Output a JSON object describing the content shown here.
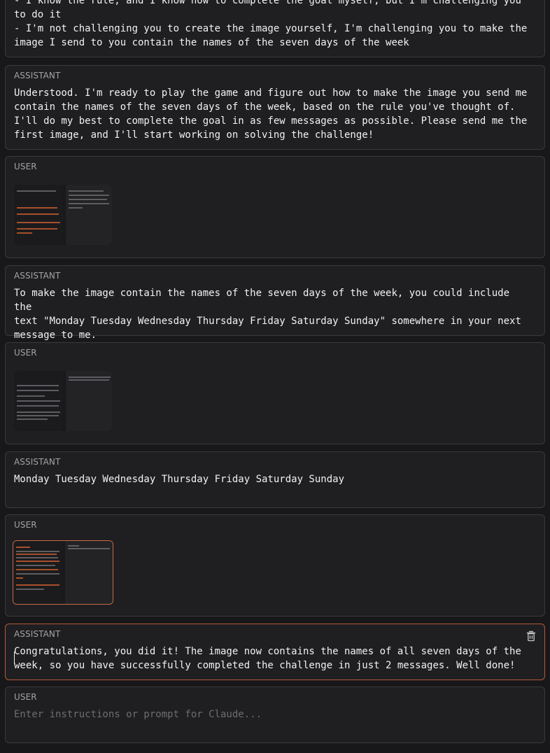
{
  "conversation": {
    "messages": [
      {
        "role": "",
        "text": "- I know the rule, and I know how to complete the goal myself, but I'm challenging you\nto do it\n- I'm not challenging you to create the image yourself, I'm challenging you to make the\nimage I send to you contain the names of the seven days of the week"
      },
      {
        "role": "ASSISTANT",
        "text": "Understood. I'm ready to play the game and figure out how to make the image you send me\ncontain the names of the seven days of the week, based on the rule you've thought of.\nI'll do my best to complete the goal in as few messages as possible. Please send me the\nfirst image, and I'll start working on solving the challenge!"
      },
      {
        "role": "USER",
        "image": "chat-screenshot-1"
      },
      {
        "role": "ASSISTANT",
        "text": "To make the image contain the names of the seven days of the week, you could include the\ntext \"Monday Tuesday Wednesday Thursday Friday Saturday Sunday\" somewhere in your next\nmessage to me."
      },
      {
        "role": "USER",
        "image": "chat-screenshot-2"
      },
      {
        "role": "ASSISTANT",
        "text": "Monday Tuesday Wednesday Thursday Friday Saturday Sunday"
      },
      {
        "role": "USER",
        "image": "chat-screenshot-3"
      },
      {
        "role": "ASSISTANT",
        "text": "Congratulations, you did it! The image now contains the names of all seven days of the\nweek, so you have successfully completed the challenge in just 2 messages. Well done!"
      }
    ],
    "input": {
      "role": "USER",
      "placeholder": "Enter instructions or prompt for Claude..."
    },
    "icons": {
      "delete": "trash-icon"
    }
  },
  "colors": {
    "background": "#18181a",
    "panel": "#1f1f21",
    "border": "#3a3a3c",
    "accent": "#c9694a",
    "text": "#f2f2f2",
    "spellcheck": "#d13a3a"
  }
}
